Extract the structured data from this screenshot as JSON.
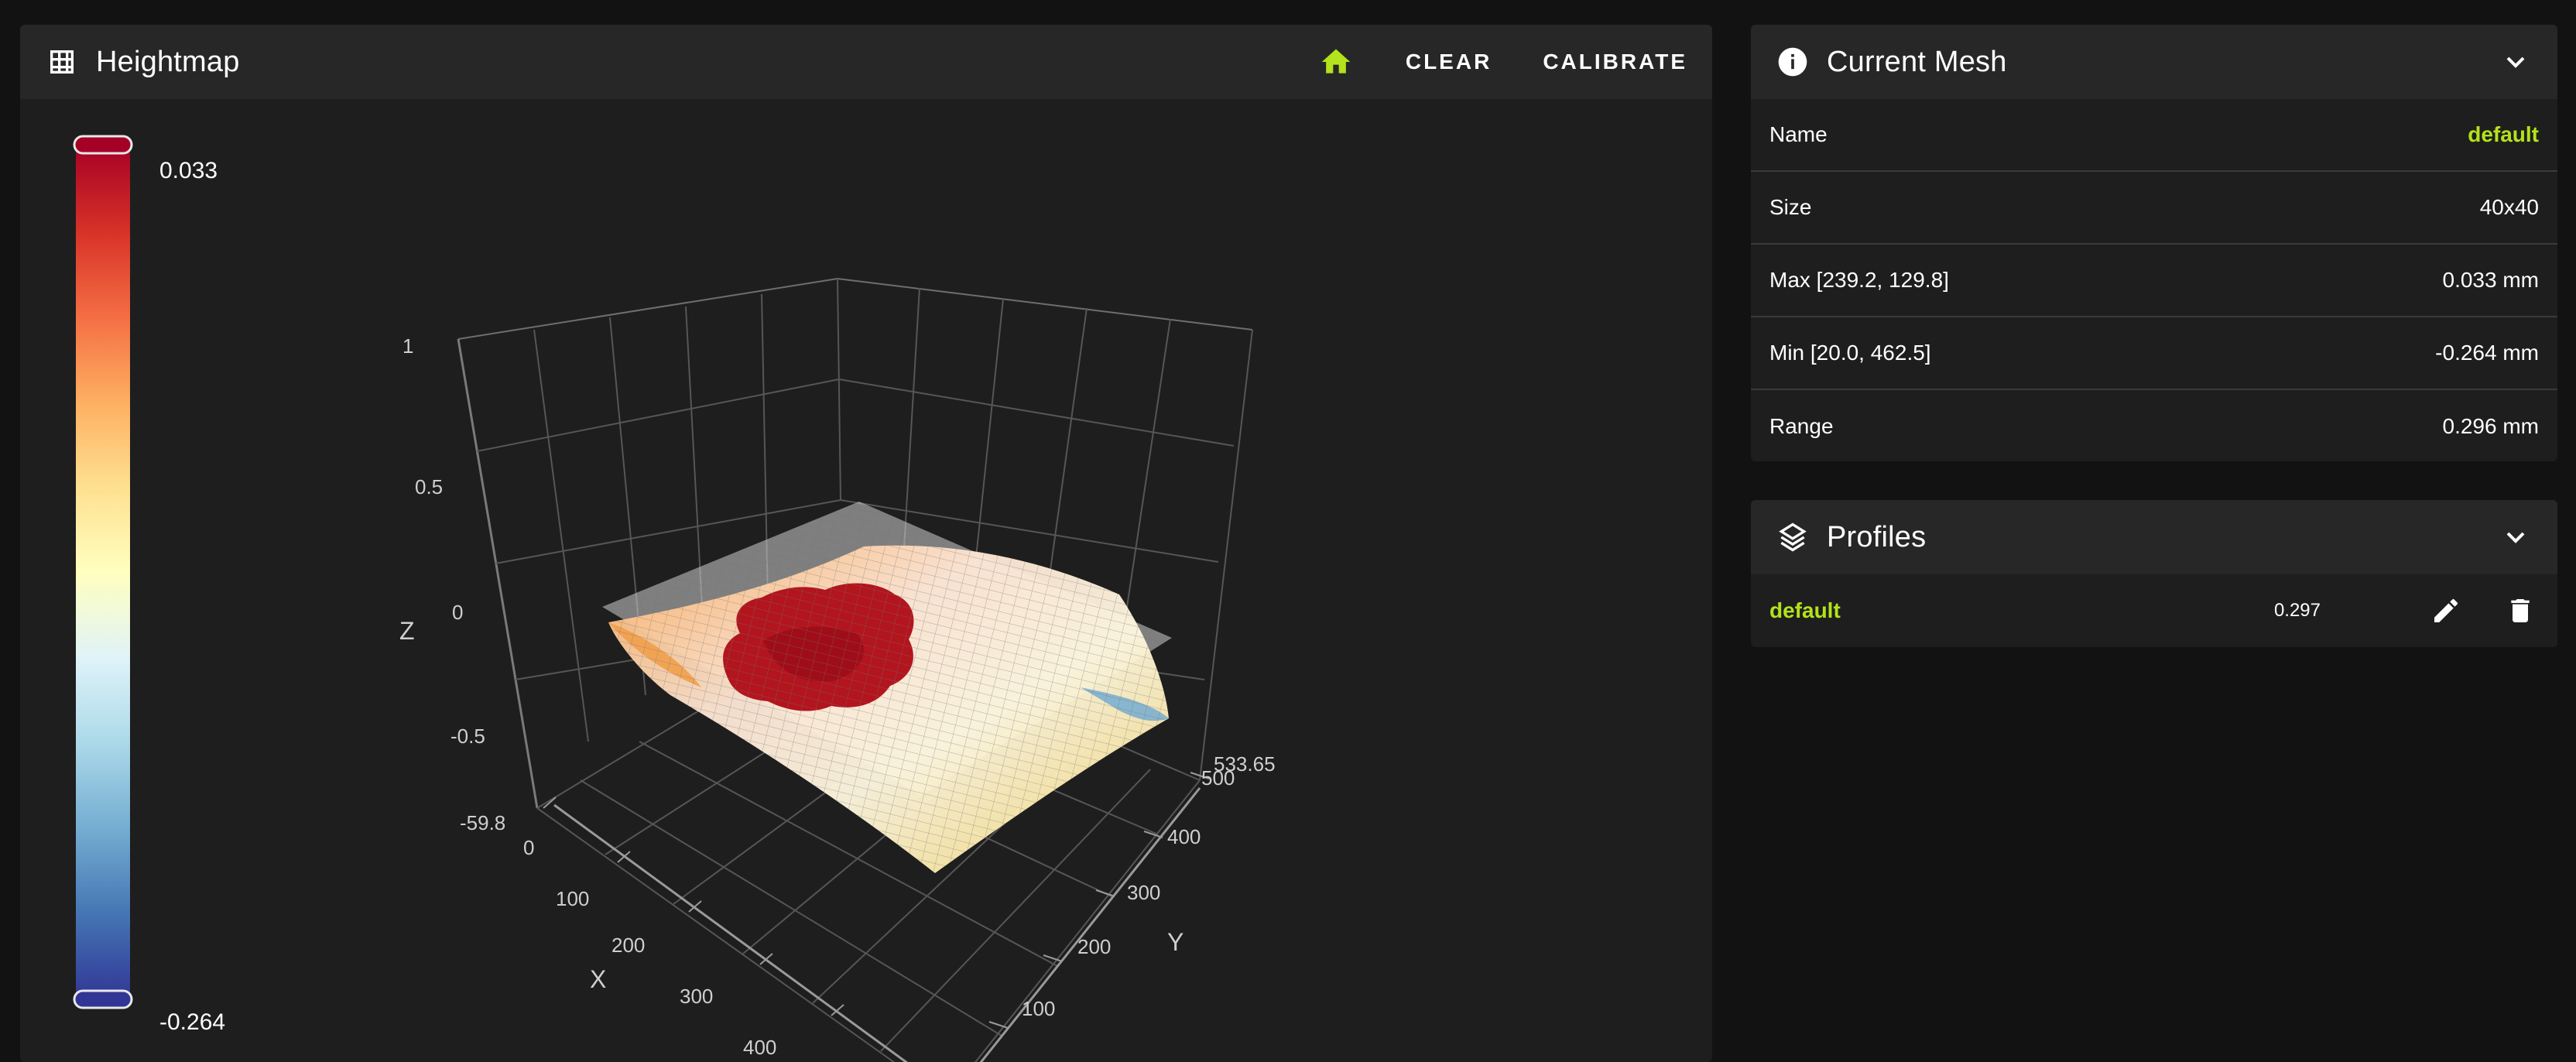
{
  "heightmap": {
    "title": "Heightmap",
    "icon": "grid-icon",
    "home_icon": "home-icon",
    "clear_label": "CLEAR",
    "calibrate_label": "CALIBRATE"
  },
  "colorbar": {
    "max_label": "0.033",
    "min_label": "-0.264",
    "colors": [
      "#a50026",
      "#d73027",
      "#f46d43",
      "#fdae61",
      "#fee090",
      "#ffffbf",
      "#e0f3f8",
      "#abd9e9",
      "#74add1",
      "#4575b4",
      "#313695"
    ]
  },
  "chart_data": {
    "type": "surface3d",
    "axes": {
      "x": {
        "label": "X",
        "ticks": [
          "0",
          "100",
          "200",
          "300",
          "400"
        ]
      },
      "y": {
        "label": "Y",
        "ticks": [
          "100",
          "200",
          "300",
          "400",
          "500"
        ],
        "max_label": "533.65"
      },
      "z": {
        "label": "Z",
        "ticks": [
          "-59.8",
          "-0.5",
          "0",
          "0.5",
          "1"
        ]
      }
    },
    "zlim": [
      -1,
      1
    ],
    "value_range": [
      -0.264,
      0.033
    ],
    "grid": true
  },
  "current_mesh": {
    "title": "Current Mesh",
    "icon": "info-icon",
    "rows": [
      {
        "label": "Name",
        "value": "default",
        "accent": true
      },
      {
        "label": "Size",
        "value": "40x40"
      },
      {
        "label": "Max [239.2, 129.8]",
        "value": "0.033 mm"
      },
      {
        "label": "Min [20.0, 462.5]",
        "value": "-0.264 mm"
      },
      {
        "label": "Range",
        "value": "0.296 mm"
      }
    ]
  },
  "profiles": {
    "title": "Profiles",
    "icon": "layers-icon",
    "items": [
      {
        "name": "default",
        "range": "0.297"
      }
    ]
  },
  "colors": {
    "accent": "#b4e21c",
    "panel": "#1e1e1e",
    "header": "#272727",
    "background": "#121212"
  }
}
